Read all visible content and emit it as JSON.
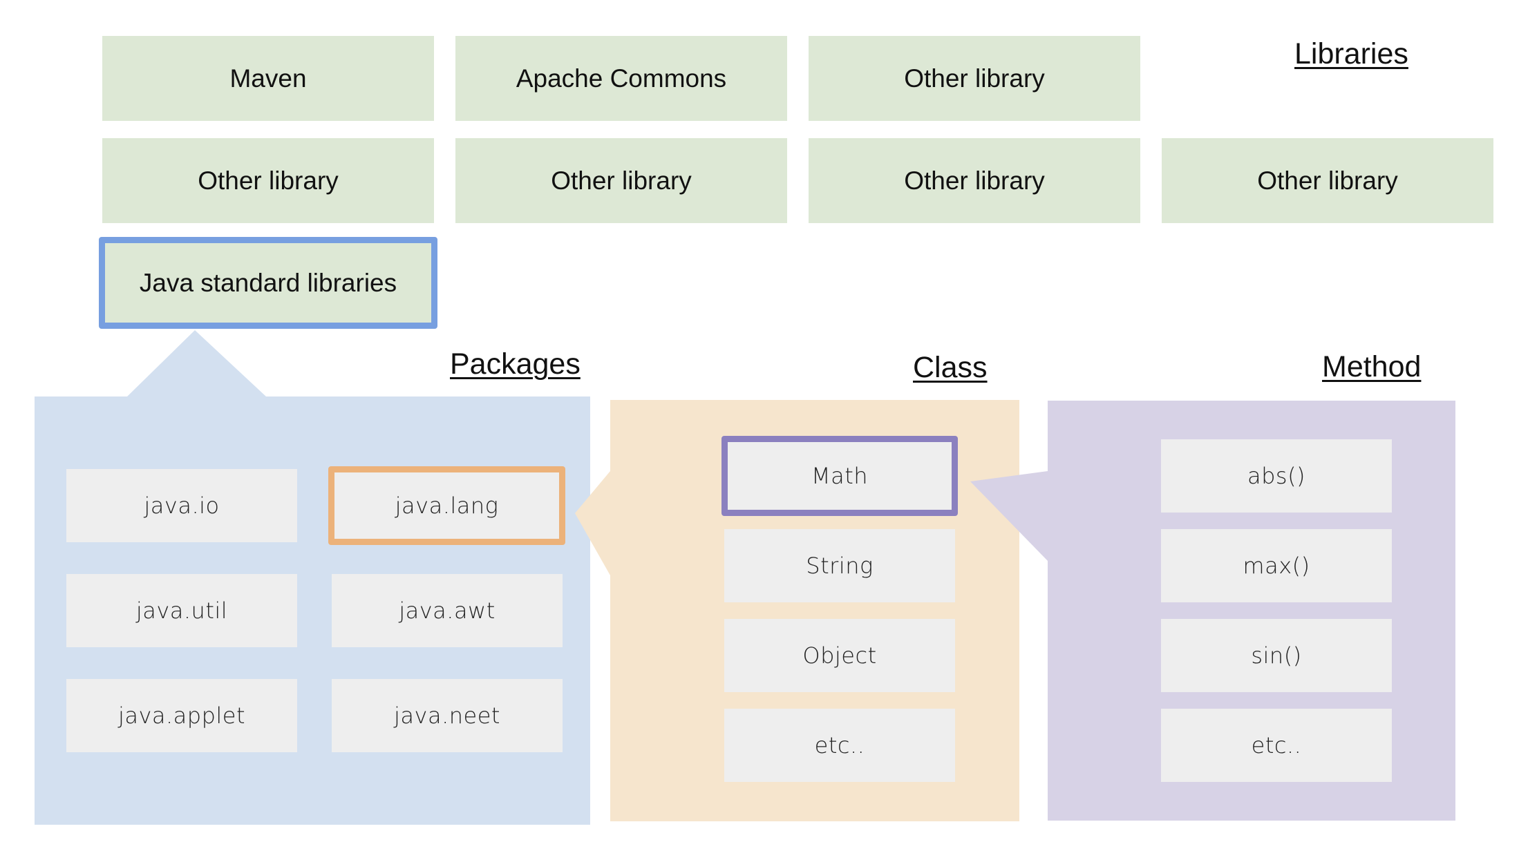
{
  "colors": {
    "library_fill": "#dde8d5",
    "std_library_border": "#779fe0",
    "packages_panel": "#d3e0f0",
    "class_panel": "#f6e5cd",
    "method_panel": "#d7d2e6",
    "item_fill": "#eeeeee",
    "java_lang_border": "#ecb27a",
    "math_border": "#8b80bf"
  },
  "titles": {
    "libraries": "Libraries",
    "packages": "Packages",
    "class": "Class",
    "method": "Method"
  },
  "libraries": {
    "row1": [
      "Maven",
      "Apache Commons",
      "Other library"
    ],
    "row2": [
      "Other library",
      "Other library",
      "Other library",
      "Other library"
    ],
    "standard": "Java standard libraries"
  },
  "packages": {
    "items": [
      "java.io",
      "java.lang",
      "java.util",
      "java.awt",
      "java.applet",
      "java.neet"
    ],
    "selected": "java.lang"
  },
  "classes": {
    "items": [
      "Math",
      "String",
      "Object",
      "etc.."
    ],
    "selected": "Math"
  },
  "methods": {
    "items": [
      "abs()",
      "max()",
      "sin()",
      "etc.."
    ]
  }
}
